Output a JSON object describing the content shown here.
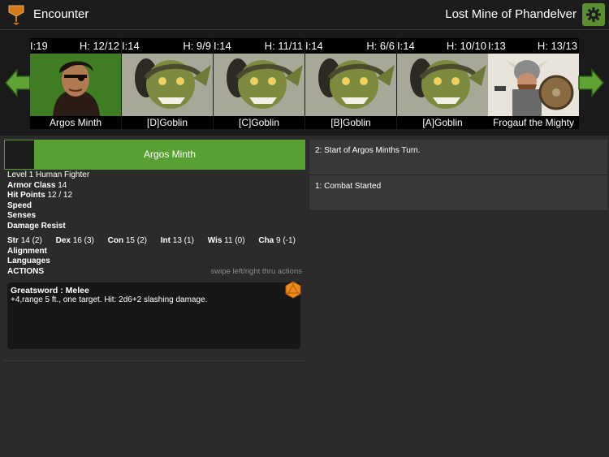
{
  "header": {
    "title": "Encounter",
    "campaign": "Lost Mine of Phandelver",
    "logo_icon": "shield-trophy-icon",
    "settings_icon": "gear-icon"
  },
  "tracker": {
    "cards": [
      {
        "init": "I:19",
        "hp": "H: 12/12",
        "name": "Argos Minth"
      },
      {
        "init": "I:14",
        "hp": "H: 9/9",
        "name": "[D]Goblin"
      },
      {
        "init": "I:14",
        "hp": "H: 11/11",
        "name": "[C]Goblin"
      },
      {
        "init": "I:14",
        "hp": "H: 6/6",
        "name": "[B]Goblin"
      },
      {
        "init": "I:14",
        "hp": "H: 10/10",
        "name": "[A]Goblin"
      },
      {
        "init": "I:13",
        "hp": "H: 13/13",
        "name": "Frogauf the Mighty"
      }
    ]
  },
  "character": {
    "name": "Argos Minth",
    "summary": "Level 1 Human Fighter",
    "armor_class_label": "Armor Class",
    "armor_class": "14",
    "hit_points_label": "Hit Points",
    "hit_points": "12 / 12",
    "speed_label": "Speed",
    "senses_label": "Senses",
    "damage_resist_label": "Damage Resist",
    "abilities": [
      {
        "label": "Str",
        "value": "14 (2)"
      },
      {
        "label": "Dex",
        "value": "16 (3)"
      },
      {
        "label": "Con",
        "value": "15 (2)"
      },
      {
        "label": "Int",
        "value": "13 (1)"
      },
      {
        "label": "Wis",
        "value": "11 (0)"
      },
      {
        "label": "Cha",
        "value": "9 (-1)"
      }
    ],
    "alignment_label": "Alignment",
    "languages_label": "Languages",
    "actions_label": "ACTIONS",
    "swipe_hint": "swipe left/right thru actions",
    "action": {
      "name": "Greatsword : Melee",
      "description": "+4,range 5 ft., one target. Hit: 2d6+2 slashing damage."
    }
  },
  "log": [
    "2: Start of Argos Minths Turn.",
    "1: Combat Started"
  ],
  "colors": {
    "accent_green": "#58a031",
    "die_orange": "#f08a1c"
  }
}
